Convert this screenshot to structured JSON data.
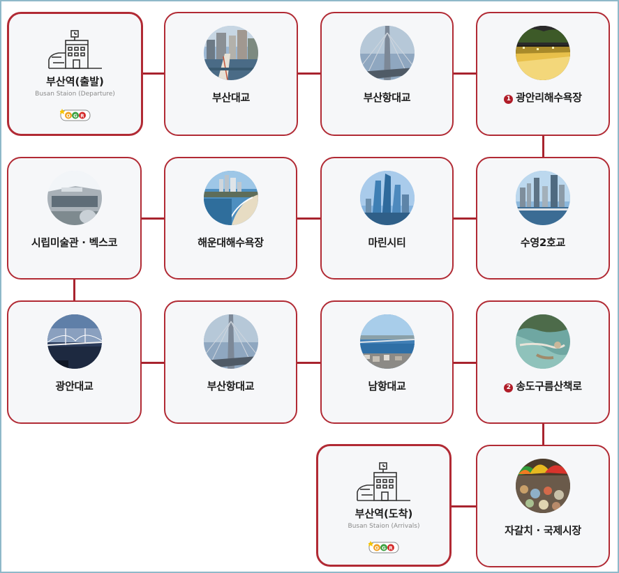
{
  "stops": [
    {
      "name": "부산역(출발)",
      "subtitle": "Busan Staion (Departure)",
      "badge": "OGR",
      "icon": "train-station-icon"
    },
    {
      "name": "부산대교",
      "photo": "busan-bridge-photo"
    },
    {
      "name": "부산항대교",
      "photo": "busan-harbor-bridge-photo"
    },
    {
      "name": "광안리해수욕장",
      "number": "1",
      "photo": "gwangalli-beach-photo"
    },
    {
      "name": "시립미술관 · 벡스코",
      "photo": "museum-bexco-photo"
    },
    {
      "name": "해운대해수욕장",
      "photo": "haeundae-beach-photo"
    },
    {
      "name": "마린시티",
      "photo": "marine-city-photo"
    },
    {
      "name": "수영2호교",
      "photo": "suyeong-bridge-photo"
    },
    {
      "name": "광안대교",
      "photo": "gwangan-bridge-photo"
    },
    {
      "name": "부산항대교",
      "photo": "busan-harbor-bridge-photo"
    },
    {
      "name": "남항대교",
      "photo": "namhang-bridge-photo"
    },
    {
      "name": "송도구름산책로",
      "number": "2",
      "photo": "songdo-skywalk-photo"
    },
    {
      "name": "부산역(도착)",
      "subtitle": "Busan Staion (Arrivals)",
      "badge": "OGR",
      "icon": "train-station-icon"
    },
    {
      "name": "자갈치 · 국제시장",
      "photo": "jagalchi-market-photo"
    }
  ],
  "badge_letters": [
    "O",
    "G",
    "R"
  ],
  "colors": {
    "border": "#b12a34",
    "connector": "#a8232e",
    "card_bg": "#f6f7f9",
    "badge_o": "#f0a020",
    "badge_g": "#3aa040",
    "badge_r": "#d42a2a",
    "number_dot": "#b01c28"
  }
}
